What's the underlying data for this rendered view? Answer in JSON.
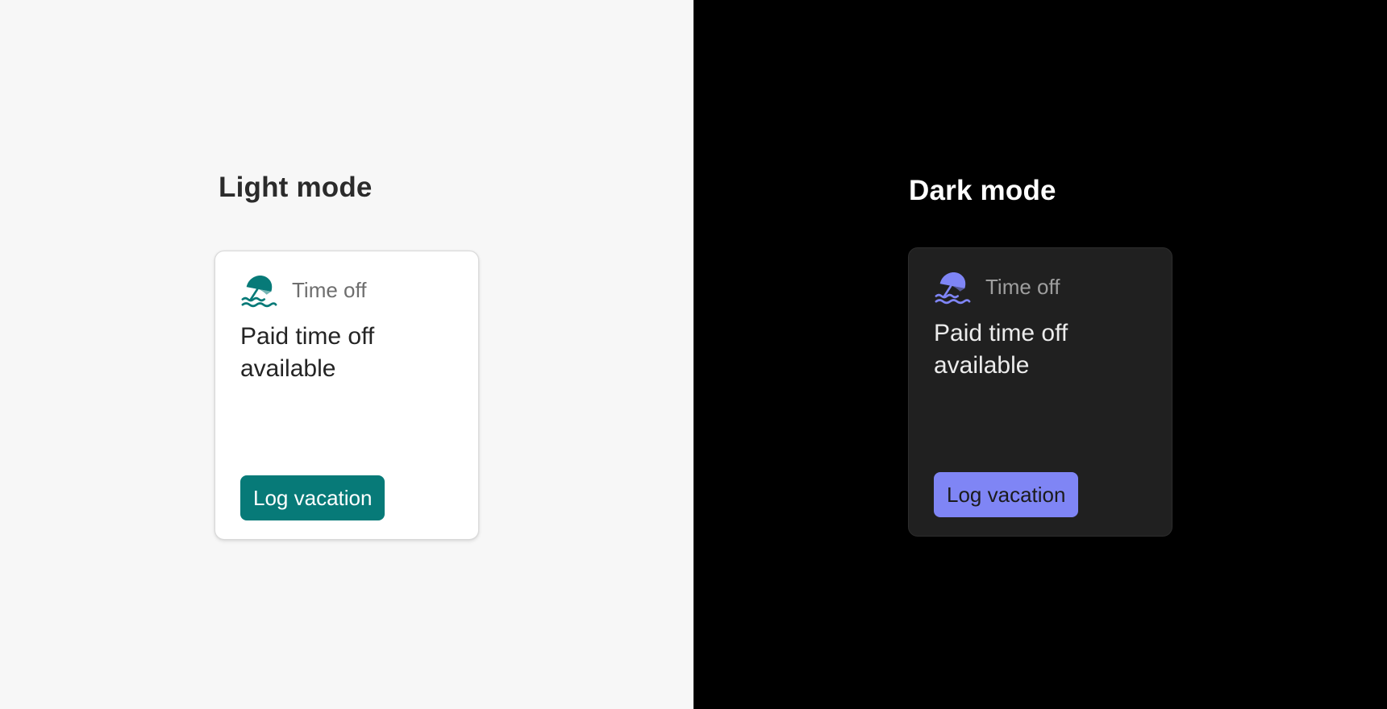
{
  "colors": {
    "light_background": "#f7f7f7",
    "dark_background": "#000000",
    "light_card": "#ffffff",
    "dark_card": "#202020",
    "light_accent": "#077a78",
    "dark_accent": "#7f85f5"
  },
  "light": {
    "mode_title": "Light mode",
    "card": {
      "icon": "beach-umbrella-icon",
      "label": "Time off",
      "body": "Paid time off available",
      "button_label": "Log vacation"
    }
  },
  "dark": {
    "mode_title": "Dark mode",
    "card": {
      "icon": "beach-umbrella-icon",
      "label": "Time off",
      "body": "Paid time off available",
      "button_label": "Log vacation"
    }
  }
}
